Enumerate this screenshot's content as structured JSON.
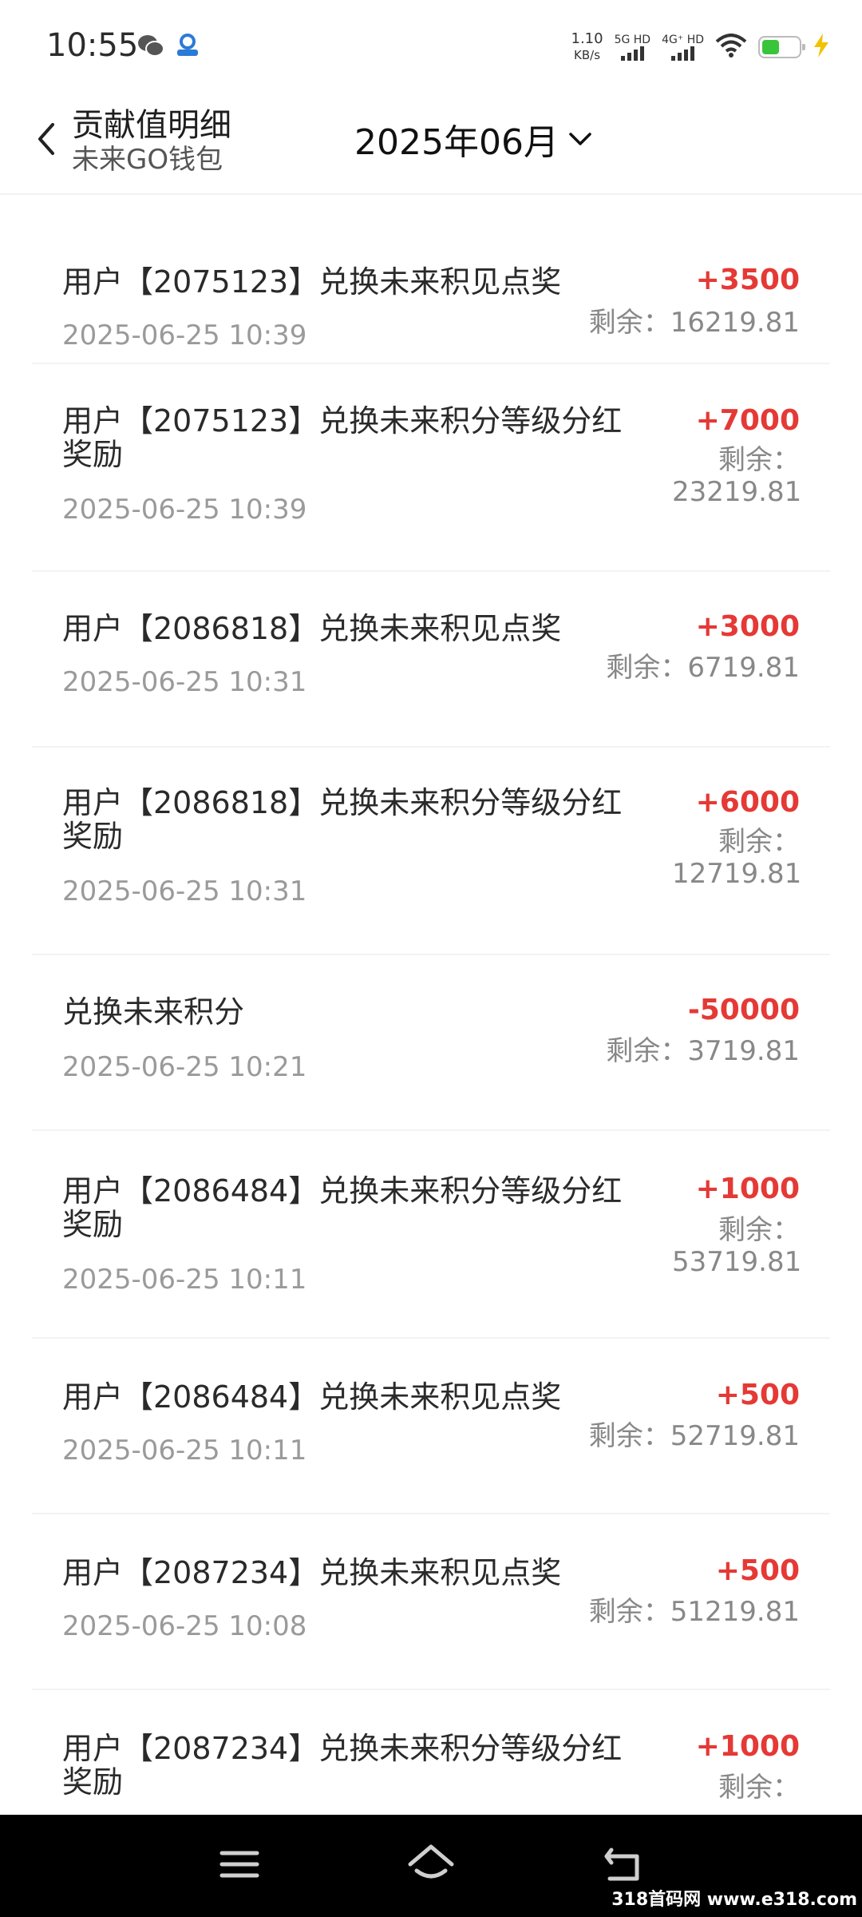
{
  "status_bar": {
    "time": "10:55",
    "speed_value": "1.10",
    "speed_unit": "KB/s",
    "sim1_label": "5G HD",
    "sim2_label": "4G⁺ HD",
    "battery_level": 0.45
  },
  "header": {
    "title": "贡献值明细",
    "subtitle": "未来GO钱包",
    "month": "2025年06月"
  },
  "records": [
    {
      "desc": "用户【2075123】兑换未来积见点奖",
      "date": "2025-06-25 10:39",
      "amount": "+3500",
      "balance": "剩余：16219.81"
    },
    {
      "desc": "用户【2075123】兑换未来积分等级分红奖励",
      "date": "2025-06-25 10:39",
      "amount": "+7000",
      "balance": "剩余：23219.81"
    },
    {
      "desc": "用户【2086818】兑换未来积见点奖",
      "date": "2025-06-25 10:31",
      "amount": "+3000",
      "balance": "剩余：6719.81"
    },
    {
      "desc": "用户【2086818】兑换未来积分等级分红奖励",
      "date": "2025-06-25 10:31",
      "amount": "+6000",
      "balance": "剩余：12719.81"
    },
    {
      "desc": "兑换未来积分",
      "date": "2025-06-25 10:21",
      "amount": "-50000",
      "balance": "剩余：3719.81"
    },
    {
      "desc": "用户【2086484】兑换未来积分等级分红奖励",
      "date": "2025-06-25 10:11",
      "amount": "+1000",
      "balance": "剩余：53719.81"
    },
    {
      "desc": "用户【2086484】兑换未来积见点奖",
      "date": "2025-06-25 10:11",
      "amount": "+500",
      "balance": "剩余：52719.81"
    },
    {
      "desc": "用户【2087234】兑换未来积见点奖",
      "date": "2025-06-25 10:08",
      "amount": "+500",
      "balance": "剩余：51219.81"
    },
    {
      "desc": "用户【2087234】兑换未来积分等级分红奖励",
      "date": "",
      "amount": "+1000",
      "balance": "剩余："
    }
  ],
  "watermark": "318首码网 www.e318.com",
  "colors": {
    "positive": "#e53935",
    "negative": "#e53935",
    "battery": "#39c43a"
  }
}
